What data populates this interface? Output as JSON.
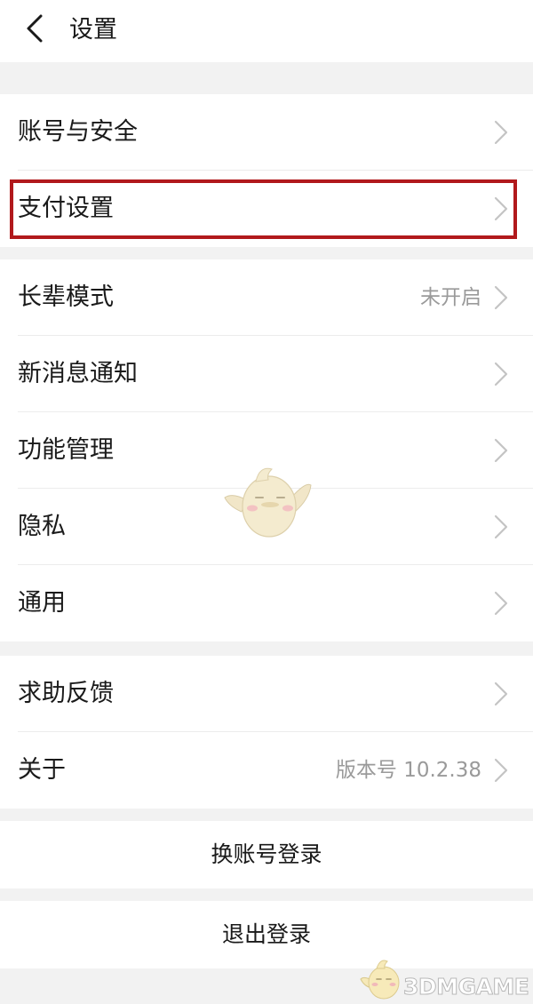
{
  "header": {
    "title": "设置",
    "back_icon": "chevron-left-icon"
  },
  "group_account": {
    "items": [
      {
        "label": "账号与安全",
        "value": ""
      },
      {
        "label": "支付设置",
        "value": ""
      }
    ]
  },
  "group_general": {
    "items": [
      {
        "label": "长辈模式",
        "value": "未开启"
      },
      {
        "label": "新消息通知",
        "value": ""
      },
      {
        "label": "功能管理",
        "value": ""
      },
      {
        "label": "隐私",
        "value": ""
      },
      {
        "label": "通用",
        "value": ""
      }
    ]
  },
  "group_help": {
    "items": [
      {
        "label": "求助反馈",
        "value": ""
      },
      {
        "label": "关于",
        "value": "版本号 10.2.38"
      }
    ]
  },
  "actions": {
    "switch_account": "换账号登录",
    "logout": "退出登录"
  },
  "watermark": {
    "text": "3DMGAME"
  },
  "colors": {
    "highlight_border": "#b1191c",
    "value_text": "#9a9a9a",
    "chevron": "#c4c4c4",
    "separator_band": "#f2f2f2"
  }
}
